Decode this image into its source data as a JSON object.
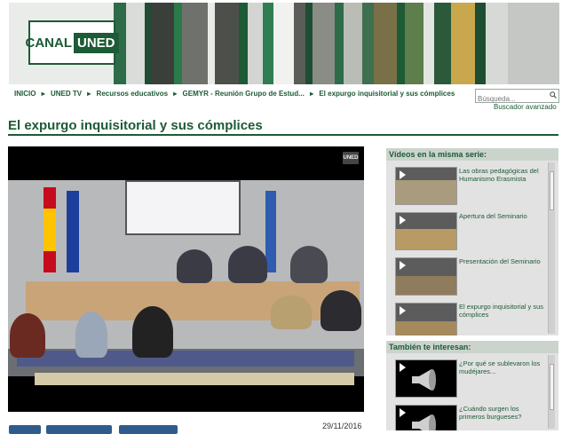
{
  "header": {
    "logo_part1": "CANAL",
    "logo_part2": "UNED"
  },
  "breadcrumb": [
    "INICIO",
    "UNED TV",
    "Recursos educativos",
    "GEMYR - Reunión Grupo de Estud...",
    "El expurgo inquisitorial y sus cómplices"
  ],
  "search": {
    "placeholder": "Búsqueda...",
    "advanced_label": "Buscador avanzado"
  },
  "page": {
    "title": "El expurgo inquisitorial y sus cómplices"
  },
  "video": {
    "watermark": "UNED",
    "date": "29/11/2016"
  },
  "sidebar": {
    "series_heading": "Vídeos en la misma serie:",
    "series_items": [
      {
        "title": "Las obras pedagógicas del Humanismo Erasmista"
      },
      {
        "title": "Apertura del Seminario"
      },
      {
        "title": "Presentación del Seminario"
      },
      {
        "title": "El expurgo inquisitorial y sus cómplices"
      }
    ],
    "related_heading": "También te interesan:",
    "related_items": [
      {
        "title": "¿Por qué se sublevaron los mudéjares..."
      },
      {
        "title": "¿Cuándo surgen los primeros burgueses?"
      }
    ]
  },
  "colors": {
    "brand_green": "#1d5a36",
    "sidebar_header": "#cbd4cc",
    "sidebar_bg": "#e2e2e2"
  }
}
